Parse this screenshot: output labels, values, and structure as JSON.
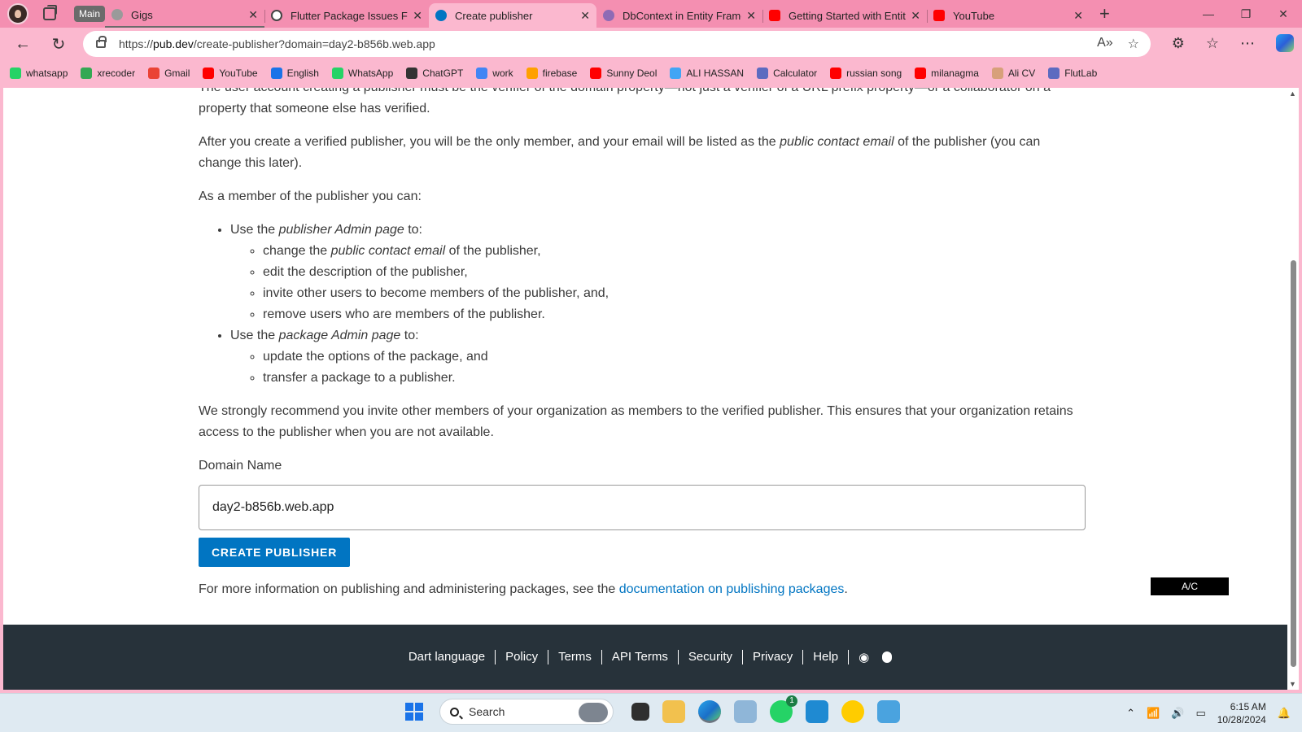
{
  "browser": {
    "tab_group_label": "Main",
    "tabs": [
      {
        "label": "Gigs",
        "color": "#9a9a9a",
        "grouped": true,
        "active": false
      },
      {
        "label": "Flutter Package Issues Fix",
        "color": "#444444",
        "grouped": false,
        "active": false
      },
      {
        "label": "Create publisher",
        "color": "#0175c2",
        "grouped": false,
        "active": true
      },
      {
        "label": "DbContext in Entity Framew",
        "color": "#8e6bb5",
        "grouped": false,
        "active": false
      },
      {
        "label": "Getting Started with Entity F",
        "color": "#ff0000",
        "grouped": false,
        "active": false
      },
      {
        "label": "YouTube",
        "color": "#ff0000",
        "grouped": false,
        "active": false
      }
    ],
    "url_prefix": "https://",
    "url_host": "pub.dev",
    "url_rest": "/create-publisher?domain=day2-b856b.web.app"
  },
  "bookmarks": [
    {
      "label": "whatsapp",
      "color": "#25d366"
    },
    {
      "label": "xrecoder",
      "color": "#34a853"
    },
    {
      "label": "Gmail",
      "color": "#ea4335"
    },
    {
      "label": "YouTube",
      "color": "#ff0000"
    },
    {
      "label": "English",
      "color": "#1a73e8"
    },
    {
      "label": "WhatsApp",
      "color": "#25d366"
    },
    {
      "label": "ChatGPT",
      "color": "#333333"
    },
    {
      "label": "work",
      "color": "#4285f4"
    },
    {
      "label": "firebase",
      "color": "#ffa000"
    },
    {
      "label": "Sunny Deol",
      "color": "#ff0000"
    },
    {
      "label": "ALI HASSAN",
      "color": "#42a5f5"
    },
    {
      "label": "Calculator",
      "color": "#5c6bc0"
    },
    {
      "label": "russian song",
      "color": "#ff0000"
    },
    {
      "label": "milanagma",
      "color": "#ff0000"
    },
    {
      "label": "Ali CV",
      "color": "#d7a07a"
    },
    {
      "label": "FlutLab",
      "color": "#5c6bc0"
    }
  ],
  "page": {
    "cut_line_1": "The user account creating a publisher must be the verifier of the domain property—not just a verifier of a URL prefix property—or a collaborator on a",
    "cut_line_2": "property that someone else has verified.",
    "para_after_pre": "After you create a verified publisher, you will be the only member, and your email will be listed as the ",
    "para_after_em": "public contact email",
    "para_after_post": " of the publisher (you can change this later).",
    "member_intro": "As a member of the publisher you can:",
    "admin_pre": "Use the ",
    "admin_em": "publisher Admin page",
    "admin_post": " to:",
    "admin_item1_pre": "change the ",
    "admin_item1_em": "public contact email",
    "admin_item1_post": " of the publisher,",
    "admin_item2": "edit the description of the publisher,",
    "admin_item3": "invite other users to become members of the publisher, and,",
    "admin_item4": "remove users who are members of the publisher.",
    "pkg_pre": "Use the ",
    "pkg_em": "package Admin page",
    "pkg_post": " to:",
    "pkg_item1": "update the options of the package, and",
    "pkg_item2": "transfer a package to a publisher.",
    "recommend": "We strongly recommend you invite other members of your organization as members to the verified publisher. This ensures that your organization retains access to the publisher when you are not available.",
    "domain_label": "Domain Name",
    "domain_value": "day2-b856b.web.app",
    "create_button": "CREATE PUBLISHER",
    "more_info_pre": "For more information on publishing and administering packages, see the ",
    "more_info_link": "documentation on publishing packages",
    "more_info_post": ".",
    "badge": "A/C"
  },
  "footer": {
    "links": [
      "Dart language",
      "Policy",
      "Terms",
      "API Terms",
      "Security",
      "Privacy",
      "Help"
    ],
    "icons": [
      "rss-icon",
      "bug-icon"
    ]
  },
  "taskbar": {
    "search_placeholder": "Search",
    "whatsapp_badge": "1",
    "time": "6:15 AM",
    "date": "10/28/2024"
  }
}
